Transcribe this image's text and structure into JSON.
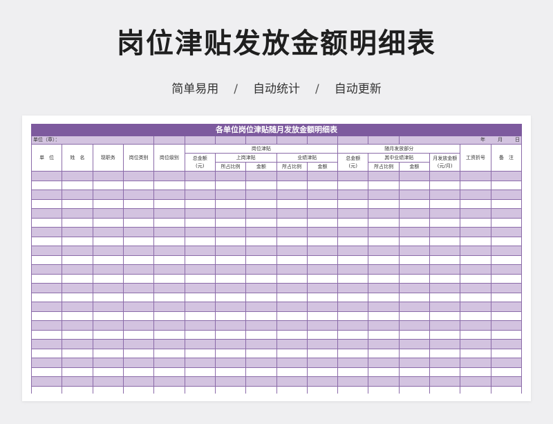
{
  "page": {
    "title": "岗位津贴发放金额明细表",
    "subtitle_items": [
      "简单易用",
      "自动统计",
      "自动更新"
    ],
    "separator": "/"
  },
  "sheet": {
    "title": "各单位岗位津贴随月发放金额明细表",
    "unit_label": "单位（章）：",
    "date_labels": [
      "年",
      "月",
      "日"
    ],
    "headers": {
      "unit": "单　位",
      "name": "姓　名",
      "current_post": "现职务",
      "post_category": "岗位类别",
      "post_level": "岗位级别",
      "post_allowance": "岗位津贴",
      "total_amount_line1": "总金额",
      "total_amount_line2": "(元)",
      "on_duty_allowance": "上岗津贴",
      "performance_allowance": "业绩津贴",
      "ratio": "所占比例",
      "amount": "金额",
      "monthly_part": "随月发放部分",
      "monthly_total_line1": "总金额",
      "monthly_total_line2": "(元)",
      "industry_performance_allowance": "其中业绩津贴",
      "monthly_amount_line1": "月发放金额",
      "monthly_amount_line2": "(元/月)",
      "salary_book": "工资折号",
      "remarks": "备　注"
    },
    "empty_row_count": 24
  },
  "colors": {
    "title_bar": "#7d5a9e",
    "band": "#d3c3e0",
    "border": "#8a6aa8"
  }
}
